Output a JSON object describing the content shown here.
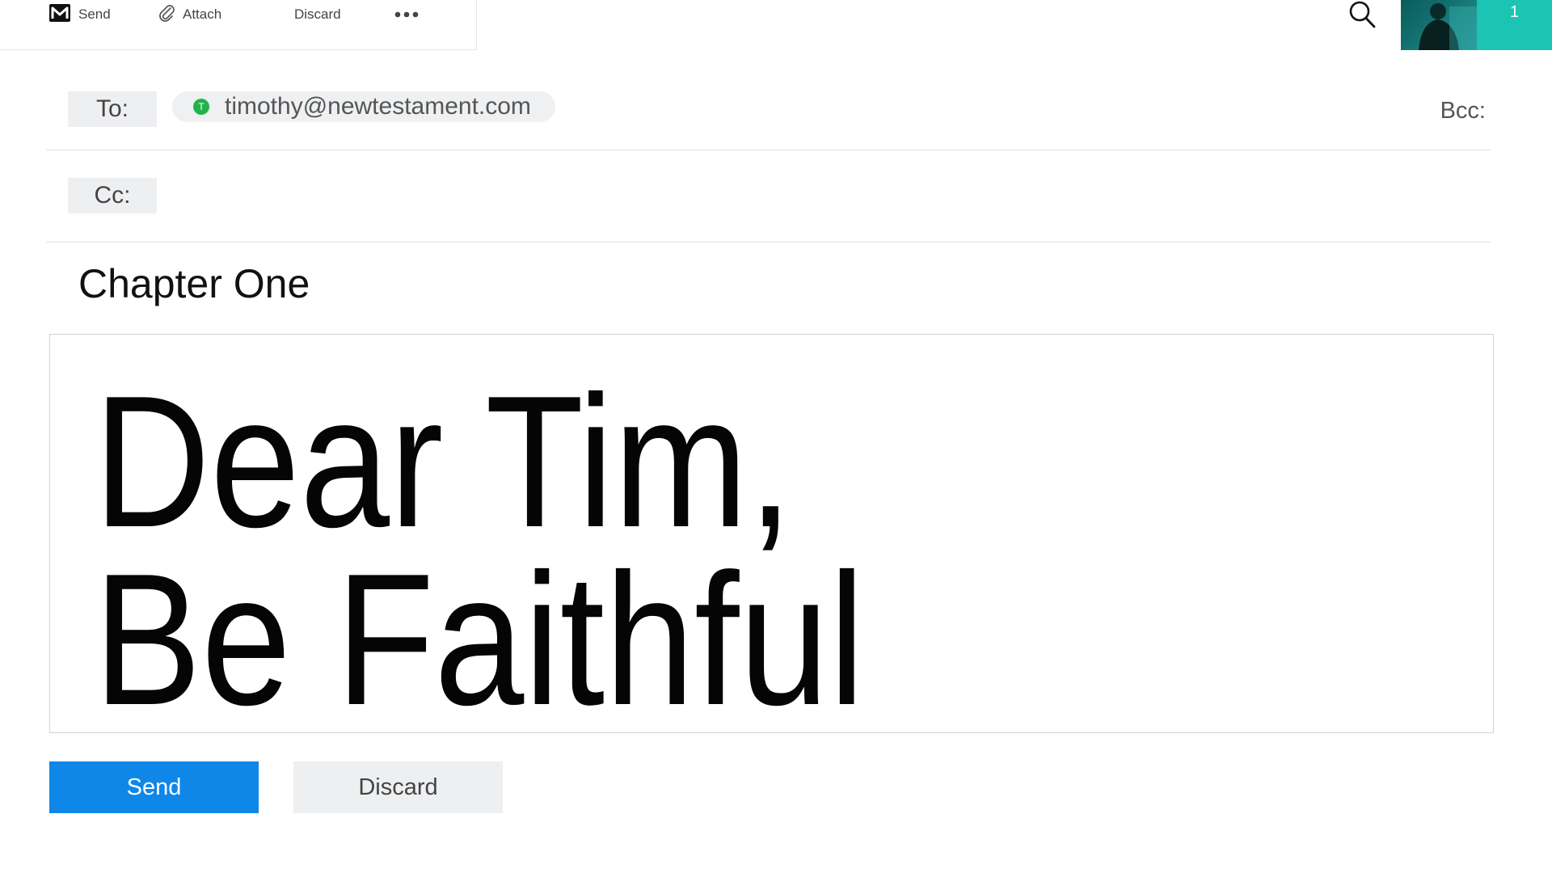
{
  "toolbar": {
    "send_label": "Send",
    "attach_label": "Attach",
    "discard_label": "Discard",
    "more_icon": "more-horizontal-icon"
  },
  "header": {
    "search_icon": "search-icon",
    "notification_count": "1",
    "accent_color": "#1cc4b3"
  },
  "compose": {
    "to_label": "To:",
    "cc_label": "Cc:",
    "bcc_label": "Bcc:",
    "recipients": [
      {
        "initial": "T",
        "email": "timothy@newtestament.com",
        "dot_color": "#22b24c"
      }
    ],
    "subject": "Chapter One",
    "body_lines": [
      "Dear Tim,",
      "Be Faithful"
    ]
  },
  "actions": {
    "send_label": "Send",
    "discard_label": "Discard",
    "send_color": "#0f87e8"
  }
}
